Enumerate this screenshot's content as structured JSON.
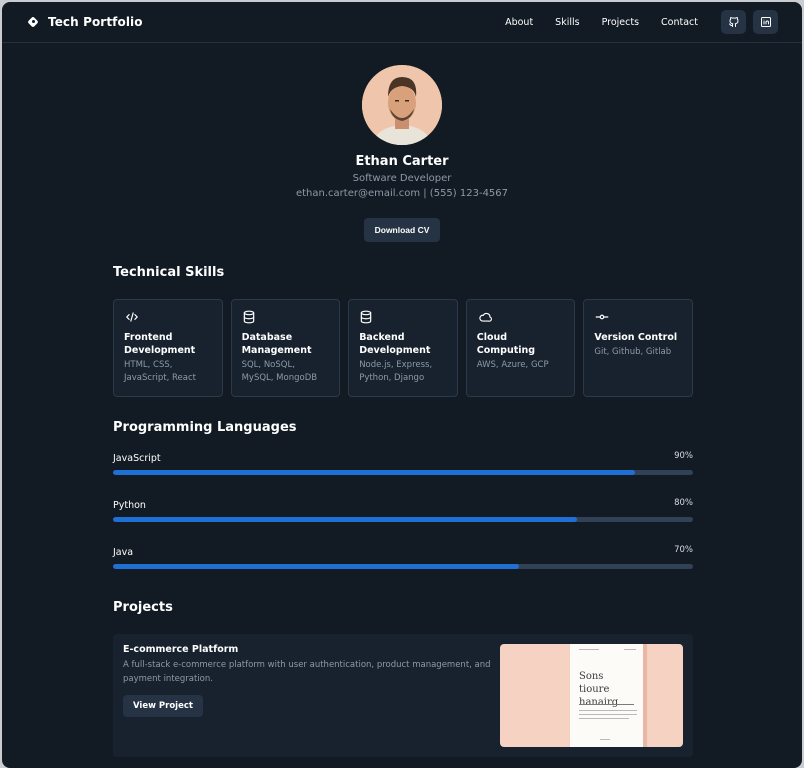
{
  "header": {
    "brand": "Tech Portfolio",
    "nav": [
      "About",
      "Skills",
      "Projects",
      "Contact"
    ],
    "social_icons": [
      "github-icon",
      "linkedin-icon"
    ]
  },
  "profile": {
    "name": "Ethan Carter",
    "role": "Software Developer",
    "contact": "ethan.carter@email.com | (555) 123-4567",
    "cv_button": "Download CV"
  },
  "skills": {
    "title": "Technical Skills",
    "items": [
      {
        "icon": "code-icon",
        "title": "Frontend Development",
        "desc": "HTML, CSS, JavaScript, React"
      },
      {
        "icon": "database-icon",
        "title": "Database Management",
        "desc": "SQL, NoSQL, MySQL, MongoDB"
      },
      {
        "icon": "database-icon",
        "title": "Backend Development",
        "desc": "Node.js, Express, Python, Django"
      },
      {
        "icon": "cloud-icon",
        "title": "Cloud Computing",
        "desc": "AWS, Azure, GCP"
      },
      {
        "icon": "git-commit-icon",
        "title": "Version Control",
        "desc": "Git, Github, Gitlab"
      }
    ]
  },
  "languages": {
    "title": "Programming Languages",
    "items": [
      {
        "name": "JavaScript",
        "percent_label": "90%",
        "percent": 90
      },
      {
        "name": "Python",
        "percent_label": "80%",
        "percent": 80
      },
      {
        "name": "Java",
        "percent_label": "70%",
        "percent": 70
      }
    ]
  },
  "projects": {
    "title": "Projects",
    "items": [
      {
        "title": "E-commerce Platform",
        "desc": "A full-stack e-commerce platform with user authentication, product management, and payment integration.",
        "button": "View Project",
        "image_text": "Sons tioure hanairg"
      }
    ]
  },
  "colors": {
    "background": "#121a23",
    "card": "#18222e",
    "button": "#253345",
    "accent": "#1f6fd4",
    "muted_text": "#8d9aa8"
  }
}
